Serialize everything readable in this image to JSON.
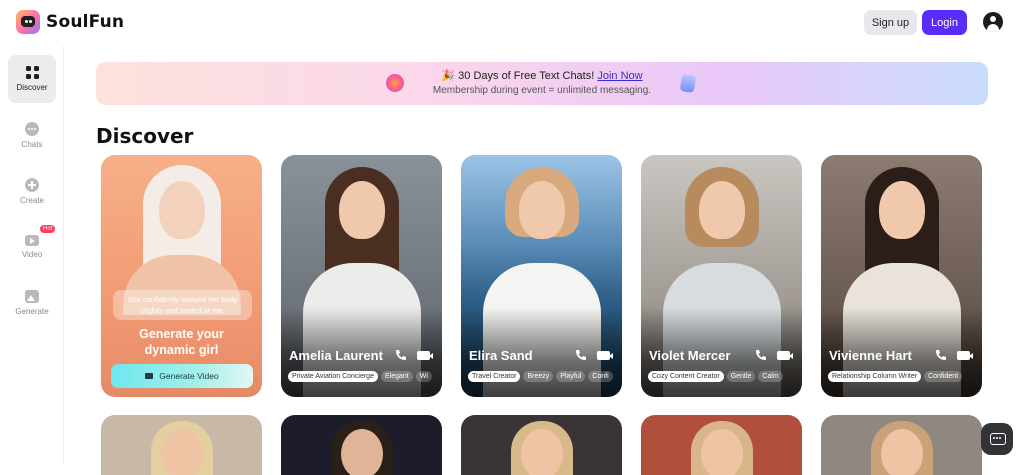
{
  "brand": {
    "name": "SoulFun"
  },
  "header": {
    "signup_label": "Sign up",
    "login_label": "Login"
  },
  "sidebar": {
    "items": [
      {
        "label": "Discover",
        "icon": "grid-icon"
      },
      {
        "label": "Chats",
        "icon": "chat-icon"
      },
      {
        "label": "Create",
        "icon": "plus-circle-icon"
      },
      {
        "label": "Video",
        "icon": "video-icon",
        "badge": "Hot"
      },
      {
        "label": "Generate",
        "icon": "image-icon"
      }
    ]
  },
  "banner": {
    "emoji": "🎉",
    "headline": "30 Days of Free Text Chats!",
    "link": "Join Now",
    "subline": "Membership during event = unlimited messaging."
  },
  "main": {
    "title": "Discover"
  },
  "promo_card": {
    "caption": "She confidently swayed her body slightly and smiled at me.",
    "headline_line1": "Generate your",
    "headline_line2": "dynamic girl",
    "button": "Generate Video"
  },
  "characters": [
    {
      "name": "Amelia Laurent",
      "tags": [
        "Private Aviation Concierge",
        "Elegant",
        "Wi"
      ]
    },
    {
      "name": "Elira Sand",
      "tags": [
        "Travel Creator",
        "Breezy",
        "Playful",
        "Confi"
      ]
    },
    {
      "name": "Violet Mercer",
      "tags": [
        "Cozy Content Creator",
        "Gentle",
        "Calm"
      ]
    },
    {
      "name": "Vivienne Hart",
      "tags": [
        "Relationship Column Writer",
        "Confident"
      ]
    }
  ],
  "colors": {
    "accent": "#5b2cf5",
    "hot_badge": "#ff3d5a"
  }
}
